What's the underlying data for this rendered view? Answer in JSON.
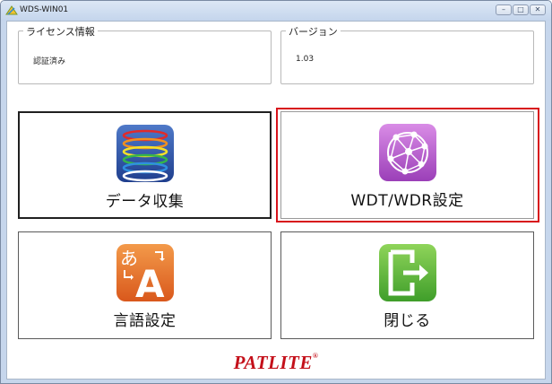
{
  "window": {
    "title": "WDS-WIN01",
    "controls": {
      "minimize": "–",
      "maximize": "□",
      "close": "✕"
    }
  },
  "license": {
    "label": "ライセンス情報",
    "value": "認証済み"
  },
  "version": {
    "label": "バージョン",
    "value": "1.03"
  },
  "tiles": [
    {
      "label": "データ収集",
      "icon": "rings-icon"
    },
    {
      "label": "WDT/WDR設定",
      "icon": "network-globe-icon",
      "selected": true
    },
    {
      "label": "言語設定",
      "icon": "language-icon"
    },
    {
      "label": "閉じる",
      "icon": "exit-icon"
    }
  ],
  "brand": {
    "name": "PATLITE",
    "mark": "®",
    "color": "#c4101a"
  },
  "colors": {
    "selection_border": "#d8131b"
  }
}
